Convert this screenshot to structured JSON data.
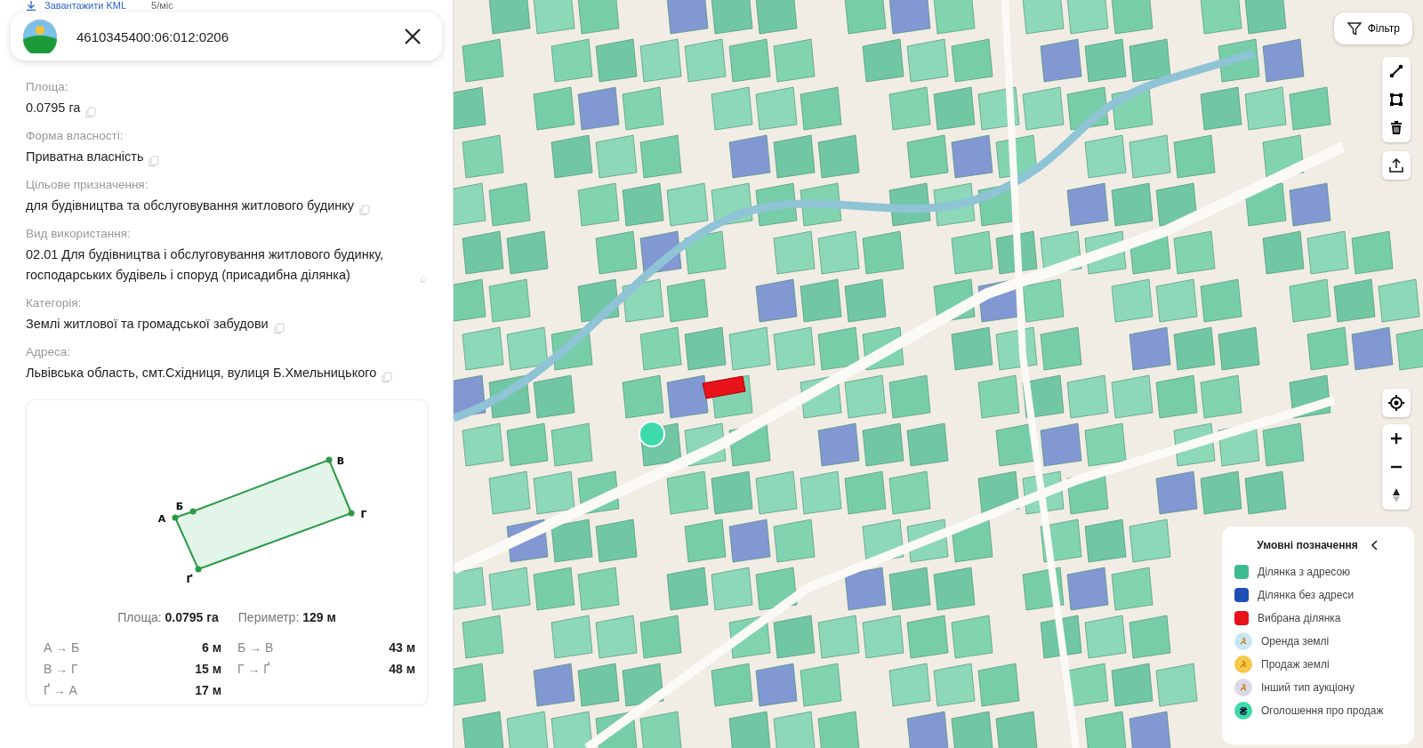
{
  "download_link": {
    "label": "Завантажити KML",
    "quota": "5/міс"
  },
  "header": {
    "title": "4610345400:06:012:0206"
  },
  "fields": [
    {
      "label": "Площа:",
      "value": "0.0795 га"
    },
    {
      "label": "Форма власності:",
      "value": "Приватна власність"
    },
    {
      "label": "Цільове призначення:",
      "value": "для будівництва та обслуговування житлового будинку"
    },
    {
      "label": "Вид використання:",
      "value": "02.01 Для будівництва і обслуговування житлового будинку, господарських будівель і споруд (присадибна ділянка)"
    },
    {
      "label": "Категорія:",
      "value": "Землі житлової та громадської забудови"
    },
    {
      "label": "Адреса:",
      "value": "Львівська область, смт.Східниця, вулиця Б.Хмельницького"
    }
  ],
  "plot": {
    "vertices": [
      "А",
      "Б",
      "В",
      "Г",
      "Ґ"
    ],
    "area_label": "Площа:",
    "area": "0.0795 га",
    "perimeter_label": "Периметр:",
    "perimeter": "129 м",
    "edges": [
      {
        "segment": "А → Б",
        "length": "6 м"
      },
      {
        "segment": "Б → В",
        "length": "43 м"
      },
      {
        "segment": "В → Г",
        "length": "15 м"
      },
      {
        "segment": "Г → Ґ",
        "length": "48 м"
      },
      {
        "segment": "Ґ → А",
        "length": "17 м"
      }
    ]
  },
  "filter_button": {
    "label": "Фільтр"
  },
  "legend": {
    "title": "Умовні позначення",
    "expanded": true,
    "items": [
      {
        "kind": "swatch",
        "color": "#3dbb8f",
        "label": "Ділянка з адресою"
      },
      {
        "kind": "swatch",
        "color": "#1f4fb5",
        "label": "Ділянка без адреси"
      },
      {
        "kind": "swatch",
        "color": "#e8121b",
        "label": "Вибрана ділянка"
      },
      {
        "kind": "marker",
        "color": "#c9e6f5",
        "label": "Оренда землі"
      },
      {
        "kind": "marker",
        "color": "#f7c94a",
        "label": "Продаж землі"
      },
      {
        "kind": "marker",
        "color": "#dcd9e6",
        "label": "Інший тип аукціону"
      },
      {
        "kind": "glyph",
        "color": "#3ddbaa",
        "glyph": "₴",
        "label": "Оголошення про продаж"
      }
    ]
  }
}
